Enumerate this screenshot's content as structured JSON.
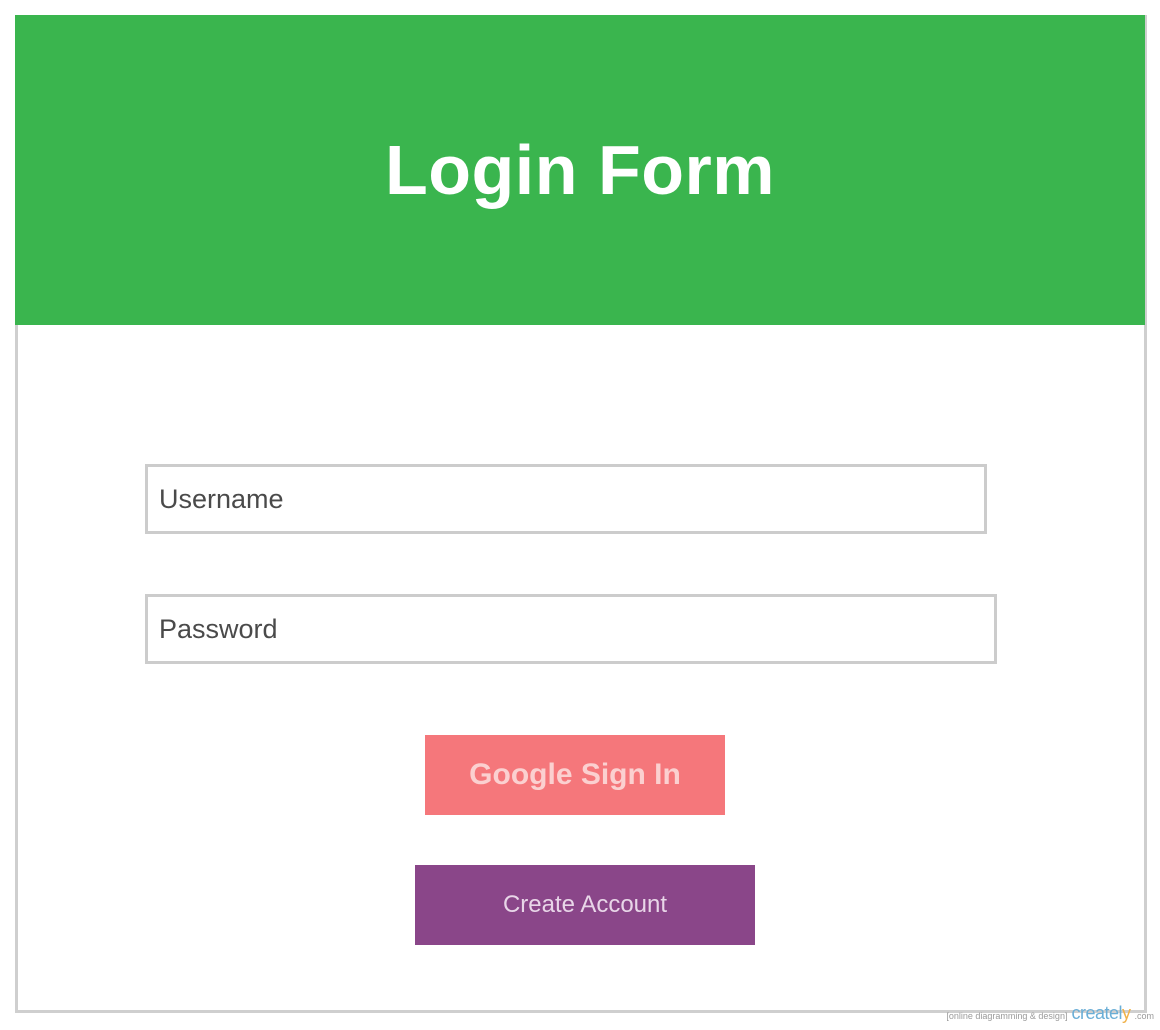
{
  "header": {
    "title": "Login Form",
    "background_color": "#3ab54e"
  },
  "form": {
    "username": {
      "placeholder": "Username",
      "value": ""
    },
    "password": {
      "placeholder": "Password",
      "value": ""
    },
    "google_sign_in_label": "Google Sign In",
    "google_sign_in_color": "#f5777b",
    "create_account_label": "Create Account",
    "create_account_color": "#8a4689"
  },
  "watermark": {
    "tagline": "[online diagramming & design]",
    "logo_text": "createl",
    "logo_y": "y",
    "logo_suffix": ".com"
  }
}
